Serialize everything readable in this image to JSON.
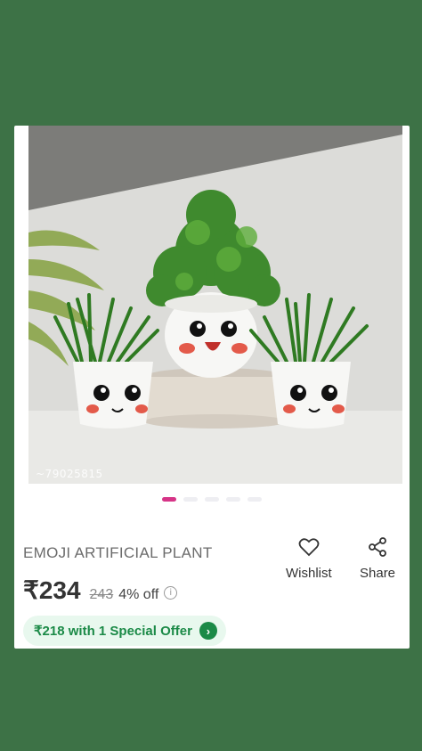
{
  "colors": {
    "background": "#3d7246",
    "accent_pink": "#d63487",
    "offer_green": "#1b8a47"
  },
  "product": {
    "image_watermark": "~79025815",
    "title": "EMOJI ARTIFICIAL PLANT",
    "price": "₹234",
    "mrp": "243",
    "discount": "4% off",
    "info_icon_glyph": "i"
  },
  "gallery": {
    "dot_count": 5,
    "active_index": 0
  },
  "actions": {
    "wishlist_label": "Wishlist",
    "share_label": "Share"
  },
  "offer": {
    "label": "₹218 with 1 Special Offer",
    "chevron": "›"
  },
  "icons": [
    "heart-icon",
    "share-icon",
    "chevron-right-icon",
    "info-icon"
  ]
}
